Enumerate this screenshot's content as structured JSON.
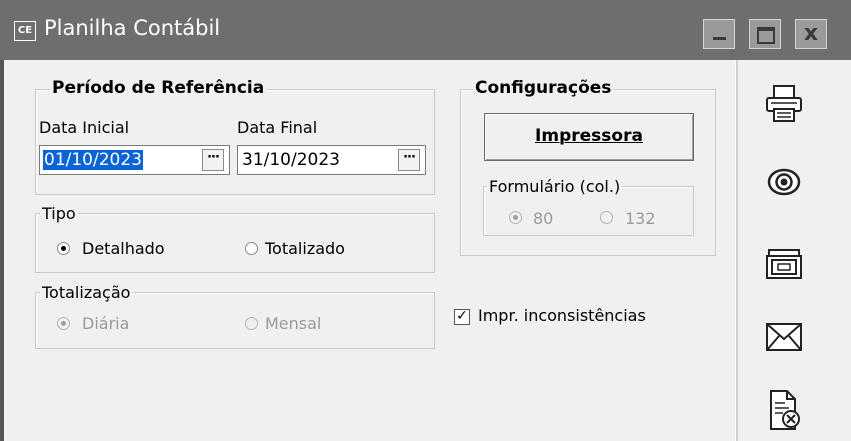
{
  "window": {
    "app_icon_text": "CE",
    "title": "Planilha Contábil",
    "min_glyph": "_",
    "close_glyph": "x"
  },
  "periodo": {
    "title": "Período de Referência",
    "data_inicial_label": "Data Inicial",
    "data_inicial_value": "01/10/2023",
    "data_final_label": "Data Final",
    "data_final_value": "31/10/2023",
    "picker_label": "···"
  },
  "tipo": {
    "title": "Tipo",
    "options": [
      "Detalhado",
      "Totalizado"
    ],
    "selected": "Detalhado"
  },
  "totalizacao": {
    "title": "Totalização",
    "options": [
      "Diária",
      "Mensal"
    ],
    "selected": "Diária",
    "disabled": true
  },
  "configuracoes": {
    "title": "Configurações",
    "printer_button": "Impressora",
    "formulario_title": "Formulário (col.)",
    "formulario_options": [
      "80",
      "132"
    ],
    "formulario_selected": "80",
    "formulario_disabled": true
  },
  "impr_inconsistencias": {
    "label": "Impr. inconsistências",
    "checked": true
  },
  "sidebar": {
    "icons": [
      "printer-icon",
      "preview-eye-icon",
      "file-cabinet-icon",
      "envelope-icon",
      "cancel-document-icon"
    ]
  },
  "colors": {
    "titlebar": "#6e6e6e",
    "selection": "#0a64d6",
    "background": "#f0f0f0"
  }
}
